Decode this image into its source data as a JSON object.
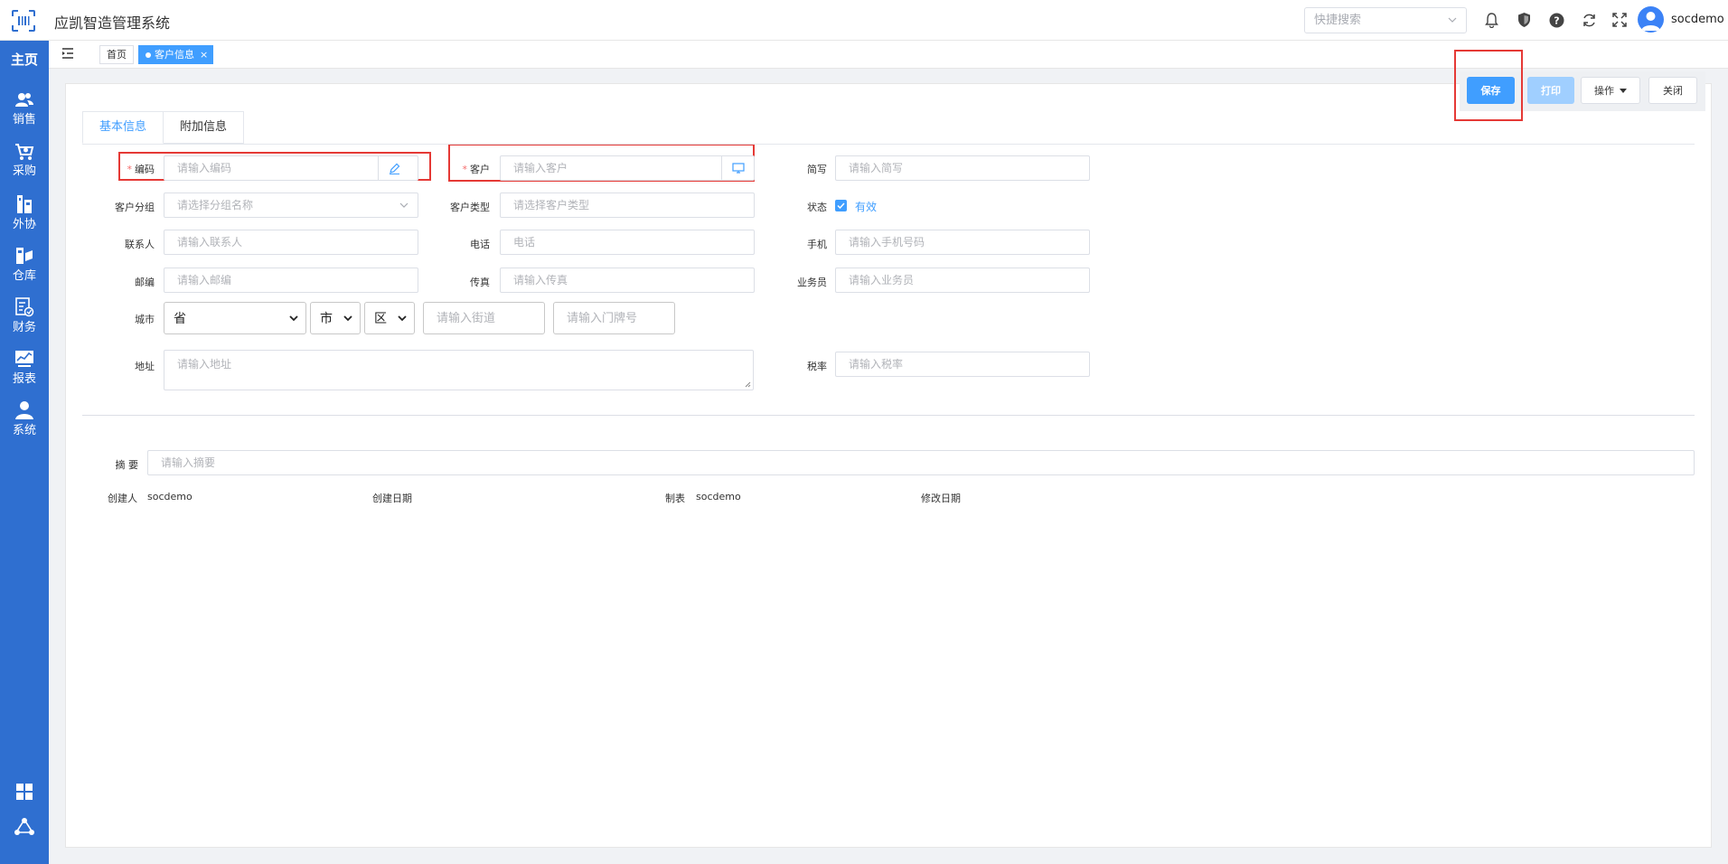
{
  "header": {
    "app_title": "应凯智造管理系统",
    "search_placeholder": "快捷搜索",
    "username": "socdemo"
  },
  "sidebar": {
    "home": "主页",
    "items": [
      {
        "label": "销售",
        "icon": "users-icon"
      },
      {
        "label": "采购",
        "icon": "cart-icon"
      },
      {
        "label": "外协",
        "icon": "outsource-icon"
      },
      {
        "label": "仓库",
        "icon": "warehouse-icon"
      },
      {
        "label": "财务",
        "icon": "finance-icon"
      },
      {
        "label": "报表",
        "icon": "report-icon"
      },
      {
        "label": "系统",
        "icon": "user-icon"
      }
    ]
  },
  "tabs": {
    "home": "首页",
    "active": "客户信息"
  },
  "toolbar": {
    "save": "保存",
    "print": "打印",
    "ops": "操作",
    "close": "关闭"
  },
  "form_tabs": [
    "基本信息",
    "附加信息"
  ],
  "form": {
    "code": {
      "label": "编码",
      "placeholder": "请输入编码"
    },
    "customer": {
      "label": "客户",
      "placeholder": "请输入客户"
    },
    "abbr": {
      "label": "简写",
      "placeholder": "请输入简写"
    },
    "group": {
      "label": "客户分组",
      "placeholder": "请选择分组名称"
    },
    "type": {
      "label": "客户类型",
      "placeholder": "请选择客户类型"
    },
    "status": {
      "label": "状态",
      "value": "有效"
    },
    "contact": {
      "label": "联系人",
      "placeholder": "请输入联系人"
    },
    "phone": {
      "label": "电话",
      "placeholder": "电话"
    },
    "mobile": {
      "label": "手机",
      "placeholder": "请输入手机号码"
    },
    "zip": {
      "label": "邮编",
      "placeholder": "请输入邮编"
    },
    "fax": {
      "label": "传真",
      "placeholder": "请输入传真"
    },
    "salesman": {
      "label": "业务员",
      "placeholder": "请输入业务员"
    },
    "city": {
      "label": "城市",
      "province": "省",
      "city": "市",
      "district": "区",
      "street_placeholder": "请输入街道",
      "door_placeholder": "请输入门牌号"
    },
    "address": {
      "label": "地址",
      "placeholder": "请输入地址"
    },
    "tax": {
      "label": "税率",
      "placeholder": "请输入税率"
    },
    "summary": {
      "label": "摘 要",
      "placeholder": "请输入摘要"
    }
  },
  "meta": {
    "creator_label": "创建人",
    "creator": "socdemo",
    "created_label": "创建日期",
    "maker_label": "制表",
    "maker": "socdemo",
    "modified_label": "修改日期"
  }
}
